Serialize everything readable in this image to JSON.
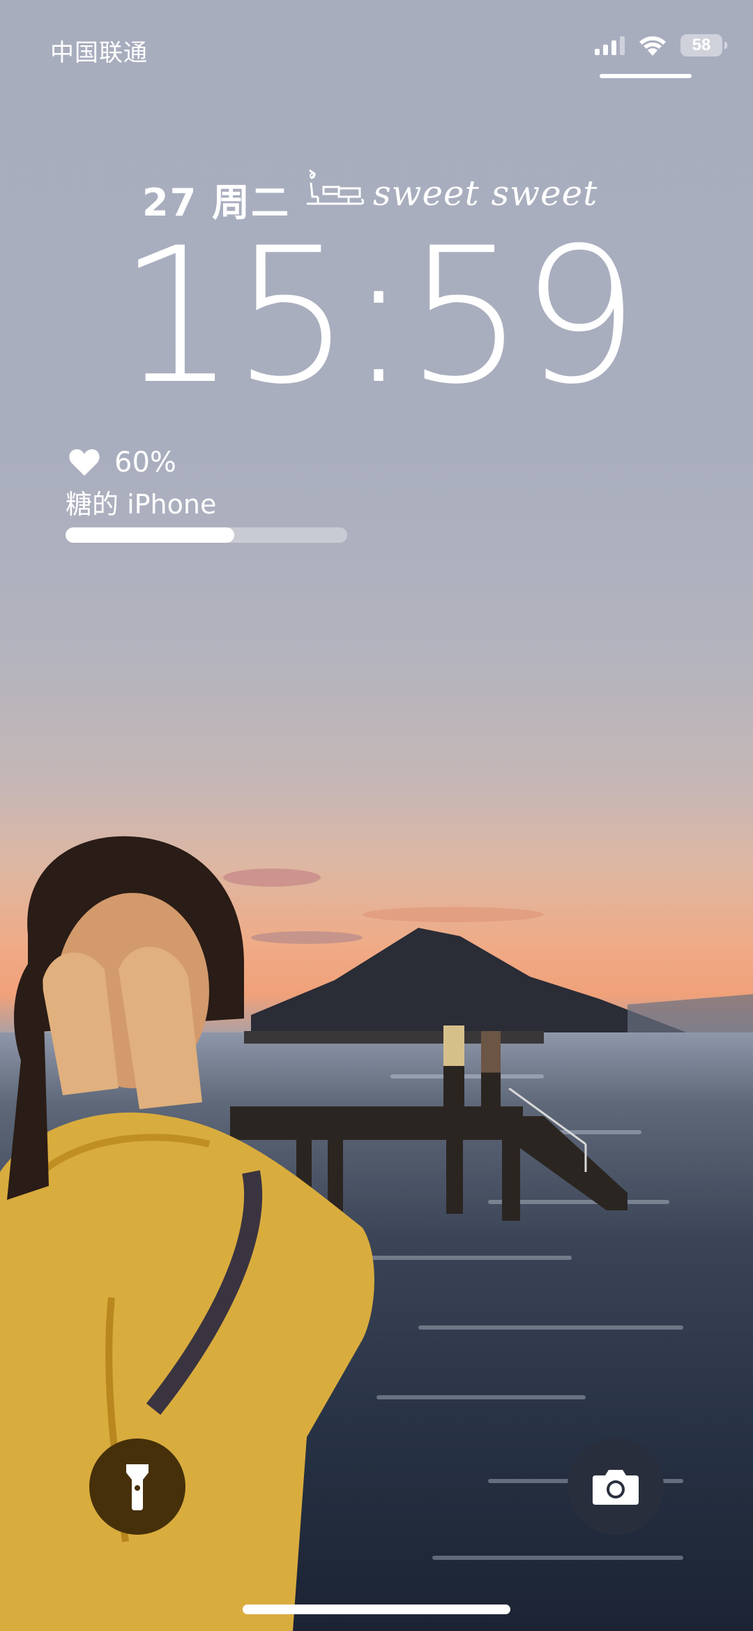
{
  "status_bar": {
    "carrier": "中国联通",
    "battery_level": "58",
    "icons": [
      "signal-bars-icon",
      "wifi-icon",
      "battery-icon"
    ]
  },
  "lock_screen": {
    "date": "27 周二",
    "widget_text": "sweet sweet",
    "widget_icon": "sleigh-icon",
    "time": "15:59"
  },
  "battery_widget": {
    "icon": "heart-icon",
    "percent_label": "60%",
    "percent_value": 0.6,
    "device_name": "糖的 iPhone"
  },
  "controls": {
    "left_button": "flashlight-icon",
    "right_button": "camera-icon"
  },
  "colors": {
    "text": "#ffffff",
    "flashlight_bg": "#46300a",
    "camera_bg": "#282e3c"
  }
}
